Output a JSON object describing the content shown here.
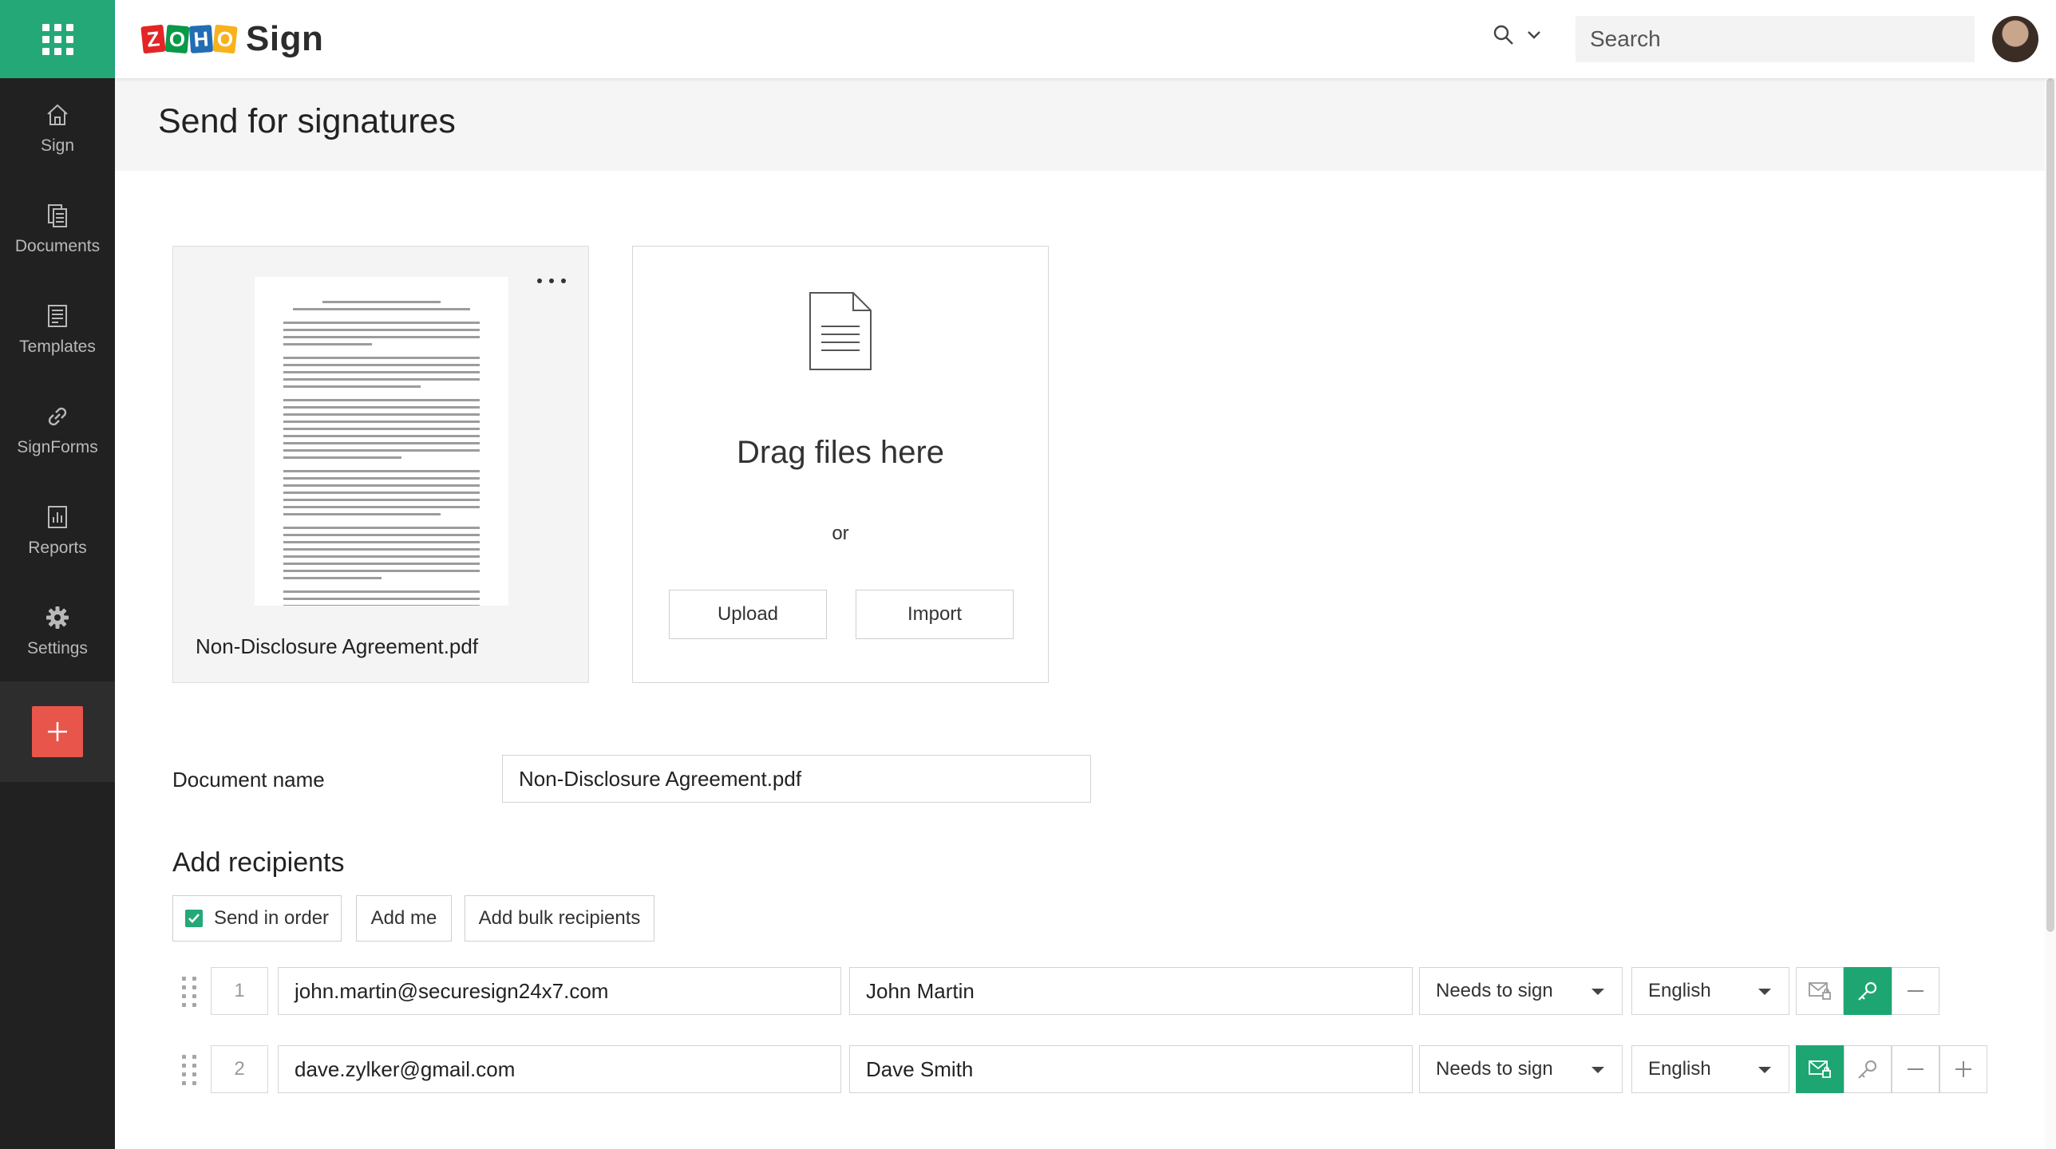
{
  "app": {
    "logo_letters": [
      "Z",
      "O",
      "H",
      "O"
    ],
    "logo_colors": [
      "#e42527",
      "#089949",
      "#226db4",
      "#f9b21d"
    ],
    "product_name": "Sign"
  },
  "topbar": {
    "search_placeholder": "Search"
  },
  "sidebar": {
    "items": [
      {
        "label": "Sign",
        "icon": "home-icon"
      },
      {
        "label": "Documents",
        "icon": "documents-icon"
      },
      {
        "label": "Templates",
        "icon": "templates-icon"
      },
      {
        "label": "SignForms",
        "icon": "link-icon"
      },
      {
        "label": "Reports",
        "icon": "reports-icon"
      },
      {
        "label": "Settings",
        "icon": "gear-icon"
      }
    ],
    "add_label": "+"
  },
  "page": {
    "title": "Send for signatures"
  },
  "document": {
    "file_name": "Non-Disclosure Agreement.pdf"
  },
  "dropzone": {
    "drag_text": "Drag files here",
    "or_text": "or",
    "upload_label": "Upload",
    "import_label": "Import"
  },
  "form": {
    "doc_name_label": "Document name",
    "doc_name_value": "Non-Disclosure Agreement.pdf",
    "recipients_title": "Add recipients",
    "send_in_order_label": "Send in order",
    "send_in_order_checked": true,
    "add_me_label": "Add me",
    "add_bulk_label": "Add bulk recipients"
  },
  "recipients": [
    {
      "order": "1",
      "email": "john.martin@securesign24x7.com",
      "name": "John Martin",
      "action": "Needs to sign",
      "language": "English"
    },
    {
      "order": "2",
      "email": "dave.zylker@gmail.com",
      "name": "Dave Smith",
      "action": "Needs to sign",
      "language": "English"
    }
  ],
  "colors": {
    "accent_green": "#24a878",
    "sidebar_bg": "#212121",
    "add_button": "#e8554b"
  }
}
